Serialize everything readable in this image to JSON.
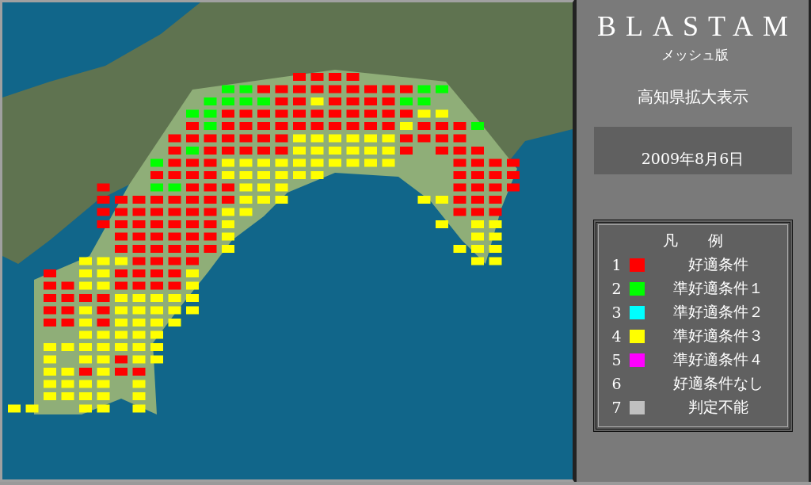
{
  "panel": {
    "title": "BLASTAM",
    "subtitle": "メッシュ版",
    "view": "高知県拡大表示",
    "date": "2009年8月6日"
  },
  "legend": {
    "heading": "凡　　例",
    "items": [
      {
        "number": "1",
        "color": "#ff0000",
        "label": "好適条件"
      },
      {
        "number": "2",
        "color": "#00ff00",
        "label": "準好適条件１"
      },
      {
        "number": "3",
        "color": "#00ffff",
        "label": "準好適条件２"
      },
      {
        "number": "4",
        "color": "#ffff00",
        "label": "準好適条件３"
      },
      {
        "number": "5",
        "color": "#ff00ff",
        "label": "準好適条件４"
      },
      {
        "number": "6",
        "label": "好適条件なし"
      },
      {
        "number": "7",
        "color": "#c0c0c0",
        "label": "判定不能"
      }
    ]
  }
}
